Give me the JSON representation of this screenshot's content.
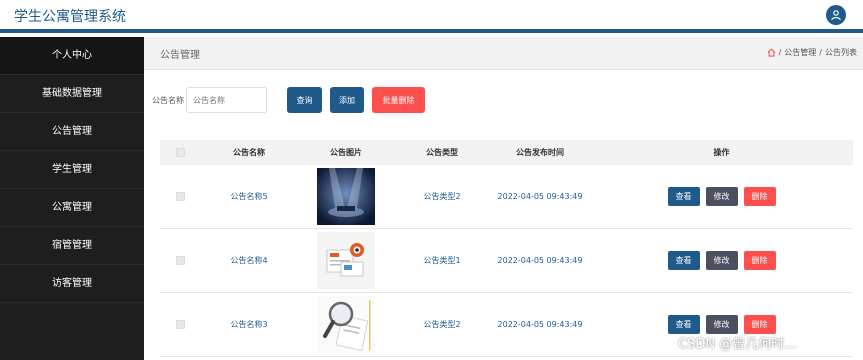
{
  "header": {
    "title": "学生公寓管理系统"
  },
  "sidebar": {
    "items": [
      {
        "label": "个人中心"
      },
      {
        "label": "基础数据管理"
      },
      {
        "label": "公告管理"
      },
      {
        "label": "学生管理"
      },
      {
        "label": "公寓管理"
      },
      {
        "label": "宿管管理"
      },
      {
        "label": "访客管理"
      }
    ]
  },
  "page": {
    "title": "公告管理",
    "breadcrumb": {
      "sep": "/",
      "level1": "公告管理",
      "level2": "公告列表"
    }
  },
  "search": {
    "label": "公告名称",
    "placeholder": "公告名称",
    "query_label": "查询",
    "add_label": "添加",
    "batch_delete_label": "批量删除"
  },
  "table": {
    "headers": {
      "name": "公告名称",
      "image": "公告图片",
      "type": "公告类型",
      "time": "公告发布时间",
      "ops": "操作"
    },
    "rows": [
      {
        "name": "公告名称5",
        "type": "公告类型2",
        "time": "2022-04-05 09:43:49",
        "image_icon": "stage-spotlight-image"
      },
      {
        "name": "公告名称4",
        "type": "公告类型1",
        "time": "2022-04-05 09:43:49",
        "image_icon": "news-paper-image"
      },
      {
        "name": "公告名称3",
        "type": "公告类型2",
        "time": "2022-04-05 09:43:49",
        "image_icon": "news-magnifier-image"
      }
    ],
    "ops": {
      "view": "查看",
      "edit": "修改",
      "delete": "删除"
    }
  },
  "colors": {
    "primary": "#1f5a8a",
    "danger": "#ff4e4e",
    "edit": "#4a5060",
    "sidebar": "#1e1e1e"
  },
  "watermark": "CSDN @曾几何时…"
}
